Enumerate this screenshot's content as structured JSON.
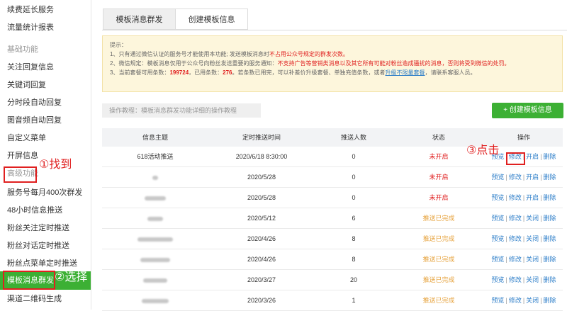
{
  "sidebar": {
    "items": [
      {
        "label": "续费延长服务",
        "type": "item"
      },
      {
        "label": "流量统计报表",
        "type": "item"
      },
      {
        "label": "基础功能",
        "type": "header"
      },
      {
        "label": "关注回复信息",
        "type": "item"
      },
      {
        "label": "关键词回复",
        "type": "item"
      },
      {
        "label": "分时段自动回复",
        "type": "item"
      },
      {
        "label": "图音频自动回复",
        "type": "item"
      },
      {
        "label": "自定义菜单",
        "type": "item"
      },
      {
        "label": "开屏信息",
        "type": "item"
      },
      {
        "label": "高级功能",
        "type": "header"
      },
      {
        "label": "服务号每月400次群发",
        "type": "item"
      },
      {
        "label": "48小时信息推送",
        "type": "item"
      },
      {
        "label": "粉丝关注定时推送",
        "type": "item"
      },
      {
        "label": "粉丝对话定时推送",
        "type": "item"
      },
      {
        "label": "粉丝点菜单定时推送",
        "type": "item"
      },
      {
        "label": "模板消息群发",
        "type": "active"
      },
      {
        "label": "渠道二维码生成",
        "type": "item"
      }
    ]
  },
  "annotations": {
    "find": "①找到",
    "select": "②选择",
    "click": "③点击"
  },
  "tabs": [
    {
      "label": "模板消息群发",
      "active": true
    },
    {
      "label": "创建模板信息",
      "active": false
    }
  ],
  "notice": {
    "title": "提示：",
    "line1_a": "1、只有通过微信认证的服务号才能使用本功能; 发送模板消息时",
    "line1_warn": "不占用公众号规定的群发次数。",
    "line2_a": "2、微信规定：模板消息仅用于公众号向粉丝发送重要的服务通知：",
    "line2_warn": "不支持广告等营销类消息以及其它所有可能对粉丝造成骚扰的消息，否则将受到微信的处罚。",
    "line3_a": "3、当前套餐可用条数：",
    "available": "199724",
    "line3_b": "，已用条数：",
    "used": "276",
    "line3_c": "。若条数已用完，可以补差价升级套餐、单独充值条数，或者",
    "upgrade_link": "升级不限量套餐",
    "line3_d": "，请联系客服人员。"
  },
  "toolbar": {
    "tutorial": "操作教程：模板消息群发功能详细的操作教程",
    "create_label": "+ 创建模板信息"
  },
  "table": {
    "headers": [
      "信息主题",
      "定时推送时间",
      "推送人数",
      "状态",
      "操作"
    ],
    "rows": [
      {
        "subject": "618活动推送",
        "time": "2020/6/18 8:30:00",
        "count": "0",
        "status": "未开启",
        "status_type": "off",
        "actions": [
          "预览",
          "修改",
          "开启",
          "删除"
        ]
      },
      {
        "subject": "",
        "time": "2020/5/28",
        "count": "0",
        "status": "未开启",
        "status_type": "off",
        "actions": [
          "预览",
          "修改",
          "开启",
          "删除"
        ]
      },
      {
        "subject": "",
        "time": "2020/5/28",
        "count": "0",
        "status": "未开启",
        "status_type": "off",
        "actions": [
          "预览",
          "修改",
          "开启",
          "删除"
        ]
      },
      {
        "subject": "",
        "time": "2020/5/12",
        "count": "6",
        "status": "推送已完成",
        "status_type": "done",
        "actions": [
          "预览",
          "修改",
          "关闭",
          "删除"
        ]
      },
      {
        "subject": "",
        "time": "2020/4/26",
        "count": "8",
        "status": "推送已完成",
        "status_type": "done",
        "actions": [
          "预览",
          "修改",
          "关闭",
          "删除"
        ]
      },
      {
        "subject": "",
        "time": "2020/4/26",
        "count": "8",
        "status": "推送已完成",
        "status_type": "done",
        "actions": [
          "预览",
          "修改",
          "关闭",
          "删除"
        ]
      },
      {
        "subject": "",
        "time": "2020/3/27",
        "count": "20",
        "status": "推送已完成",
        "status_type": "done",
        "actions": [
          "预览",
          "修改",
          "关闭",
          "删除"
        ]
      },
      {
        "subject": "",
        "time": "2020/3/26",
        "count": "1",
        "status": "推送已完成",
        "status_type": "done",
        "actions": [
          "预览",
          "修改",
          "关闭",
          "删除"
        ]
      }
    ]
  },
  "colors": {
    "accent_green": "#3cb034",
    "annotation_red": "#e02020",
    "link_blue": "#2a7cc8",
    "done_orange": "#e6a23c"
  }
}
